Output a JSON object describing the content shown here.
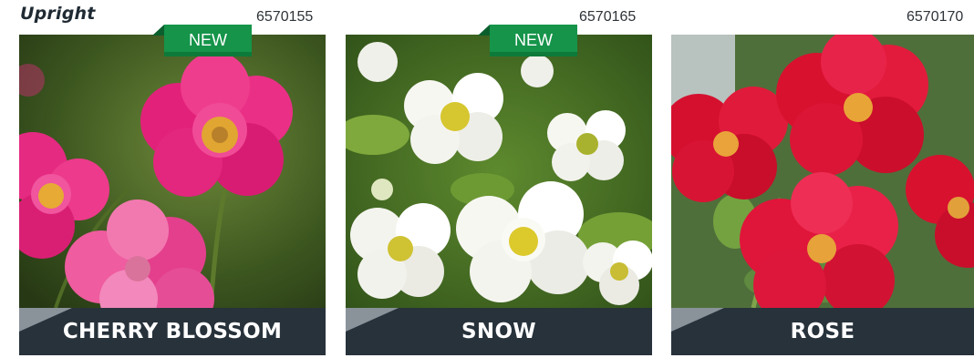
{
  "section": {
    "title": "Upright"
  },
  "badge": {
    "label": "NEW"
  },
  "cards": [
    {
      "sku": "6570155",
      "name": "CHERRY BLOSSOM",
      "is_new": true,
      "flower_color": "#e6257f",
      "center_color": "#e0a32a"
    },
    {
      "sku": "6570165",
      "name": "SNOW",
      "is_new": true,
      "flower_color": "#f7f7f1",
      "center_color": "#d9c32c"
    },
    {
      "sku": "6570170",
      "name": "ROSE",
      "is_new": false,
      "flower_color": "#dc1238",
      "center_color": "#e6a12d"
    }
  ],
  "colors": {
    "name_bar": "#27323b",
    "badge": "#15944a",
    "corner_accent": "#8a929a"
  }
}
